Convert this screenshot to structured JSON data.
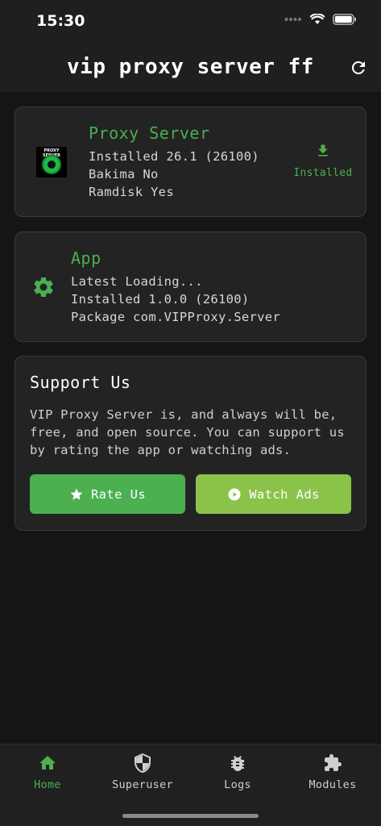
{
  "status_bar": {
    "time": "15:30"
  },
  "app_bar": {
    "title": "vip proxy server ff"
  },
  "proxy_card": {
    "title": "Proxy Server",
    "logo_text": "PROXY SERVER",
    "installed": "Installed 26.1 (26100)",
    "bakima": "Bakima No",
    "ramdisk": "Ramdisk Yes",
    "action_label": "Installed"
  },
  "app_card": {
    "title": "App",
    "latest": "Latest Loading...",
    "installed": "Installed 1.0.0 (26100)",
    "package": "Package com.VIPProxy.Server"
  },
  "support_card": {
    "title": "Support Us",
    "line1": "VIP Proxy Server is, and always will be,",
    "line2": "free, and open source. You can support us",
    "line3": "by rating the app or watching ads.",
    "rate_label": "Rate Us",
    "ads_label": "Watch Ads"
  },
  "nav": {
    "items": [
      {
        "label": "Home",
        "icon": "home-icon"
      },
      {
        "label": "Superuser",
        "icon": "shield-icon"
      },
      {
        "label": "Logs",
        "icon": "bug-icon"
      },
      {
        "label": "Modules",
        "icon": "puzzle-icon"
      }
    ]
  },
  "colors": {
    "accent": "#4caf50",
    "accent_light": "#8bc34a",
    "background": "#151515",
    "card": "#232323"
  }
}
